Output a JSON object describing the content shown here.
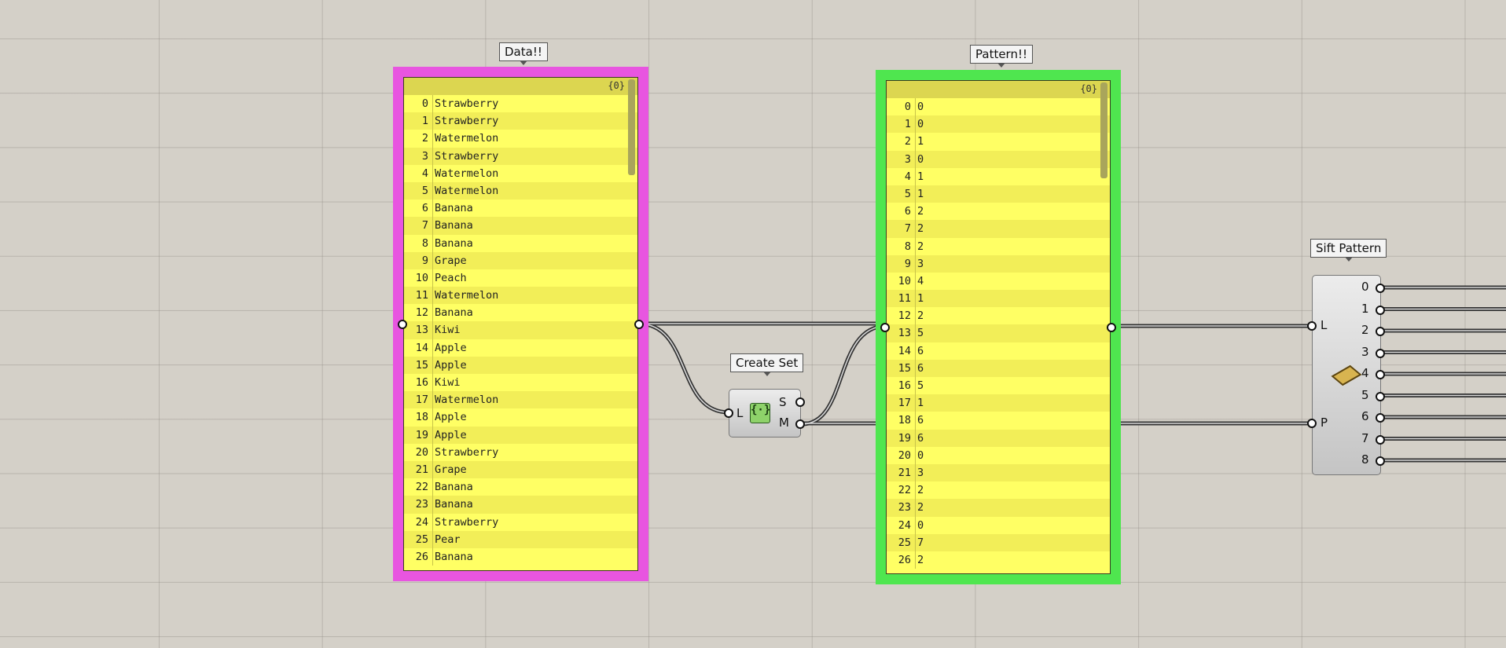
{
  "data_panel": {
    "title": "Data!!",
    "path": "{0}",
    "frame_color": "#e855e0",
    "items": [
      "Strawberry",
      "Strawberry",
      "Watermelon",
      "Strawberry",
      "Watermelon",
      "Watermelon",
      "Banana",
      "Banana",
      "Banana",
      "Grape",
      "Peach",
      "Watermelon",
      "Banana",
      "Kiwi",
      "Apple",
      "Apple",
      "Kiwi",
      "Watermelon",
      "Apple",
      "Apple",
      "Strawberry",
      "Grape",
      "Banana",
      "Banana",
      "Strawberry",
      "Pear",
      "Banana"
    ]
  },
  "pattern_panel": {
    "title": "Pattern!!",
    "path": "{0}",
    "frame_color": "#4fe64f",
    "items": [
      "0",
      "0",
      "1",
      "0",
      "1",
      "1",
      "2",
      "2",
      "2",
      "3",
      "4",
      "1",
      "2",
      "5",
      "6",
      "6",
      "5",
      "1",
      "6",
      "6",
      "0",
      "3",
      "2",
      "2",
      "0",
      "7",
      "2"
    ]
  },
  "create_set": {
    "title": "Create Set",
    "input_label": "L",
    "output_labels": [
      "S",
      "M"
    ],
    "icon": "create-set-icon"
  },
  "sift_pattern": {
    "title": "Sift Pattern",
    "input_labels": [
      "L",
      "P"
    ],
    "output_labels": [
      "0",
      "1",
      "2",
      "3",
      "4",
      "5",
      "6",
      "7",
      "8"
    ],
    "icon": "sift-pattern-icon"
  }
}
